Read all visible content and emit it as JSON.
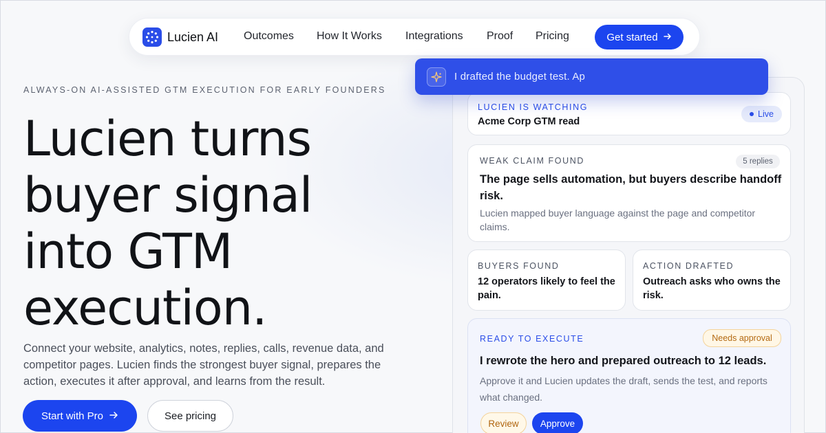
{
  "nav": {
    "brand": "Lucien AI",
    "links": [
      "Outcomes",
      "How It Works",
      "Integrations",
      "Proof",
      "Pricing"
    ],
    "cta": "Get started",
    "logo_icon": "dotted-ring-logo-icon"
  },
  "hero": {
    "eyebrow": "ALWAYS-ON AI-ASSISTED GTM EXECUTION FOR EARLY FOUNDERS",
    "headline_lines": [
      "Lucien turns",
      "buyer signal",
      "into GTM",
      "execution."
    ],
    "subcopy": "Connect your website, analytics, notes, replies, calls, revenue data, and competitor pages. Lucien finds the strongest buyer signal, prepares the action, executes it after approval, and learns from the result.",
    "primary_cta": "Start with Pro",
    "secondary_cta": "See pricing"
  },
  "toast": {
    "text": "I drafted the budget test. Ap",
    "icon": "sparkle-icon"
  },
  "panel": {
    "watching": {
      "label": "LUCIEN IS WATCHING",
      "title": "Acme Corp GTM read",
      "badge": "Live"
    },
    "weak_claim": {
      "label": "WEAK CLAIM FOUND",
      "badge": "5 replies",
      "title": "The page sells automation, but buyers describe handoff risk.",
      "body": "Lucien mapped buyer language against the page and competitor claims."
    },
    "buyers_found": {
      "label": "BUYERS FOUND",
      "title": "12 operators likely to feel the pain."
    },
    "action_drafted": {
      "label": "ACTION DRAFTED",
      "title": "Outreach asks who owns the risk."
    },
    "ready": {
      "label": "READY TO EXECUTE",
      "badge": "Needs approval",
      "title": "I rewrote the hero and prepared outreach to 12 leads.",
      "body": "Approve it and Lucien updates the draft, sends the test, and reports what changed.",
      "review": "Review",
      "approve": "Approve"
    }
  },
  "colors": {
    "accent": "#1c45ef",
    "amber": "#b46a12",
    "text": "#111317"
  }
}
